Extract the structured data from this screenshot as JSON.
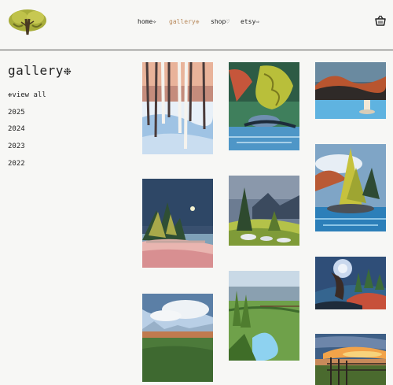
{
  "nav": {
    "home": "home✧",
    "gallery": "gallery❉",
    "shop": "shop♡",
    "etsy": "etsy⇨"
  },
  "colors": {
    "nav_active": "#b98a5c",
    "text": "#222222",
    "header_rule": "#555555"
  },
  "icons": {
    "logo": "tree-logo-icon",
    "cart": "shopping-basket-icon"
  },
  "sidebar": {
    "title": "gallery❉",
    "items": [
      "❉view all",
      "2025",
      "2024",
      "2023",
      "2022"
    ]
  },
  "gallery": {
    "artworks": [
      {
        "subject": "snowy birch forest"
      },
      {
        "subject": "golden tamarack by lake"
      },
      {
        "subject": "autumn shoreline with stump"
      },
      {
        "subject": "golden tree on rocky island"
      },
      {
        "subject": "pine island at night with moon"
      },
      {
        "subject": "pines above mountain valley"
      },
      {
        "subject": "moonlit tree over river"
      },
      {
        "subject": "open field with distant mountains"
      },
      {
        "subject": "green valley stream with fence"
      },
      {
        "subject": "sunset over fence and field"
      }
    ]
  }
}
